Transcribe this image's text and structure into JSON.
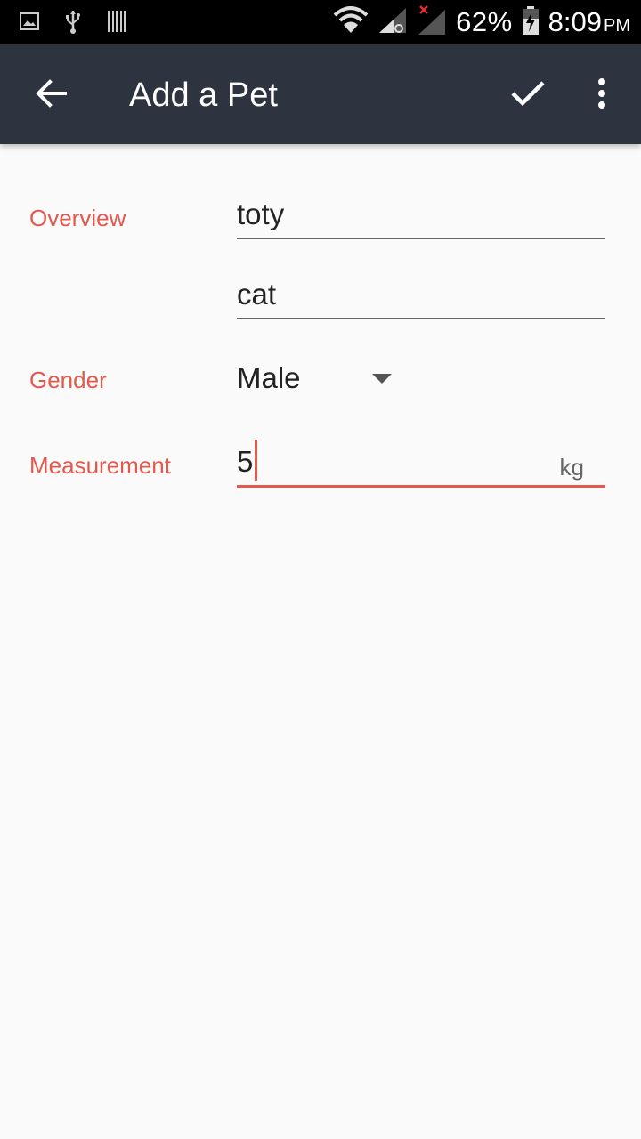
{
  "status_bar": {
    "battery_percent": "62%",
    "time": "8:09",
    "ampm": "PM",
    "icons": [
      "image-icon",
      "usb-icon",
      "barcode-icon",
      "wifi-icon",
      "signal-icon",
      "signal-no-sim-icon",
      "battery-charging-icon"
    ]
  },
  "app_bar": {
    "title": "Add a Pet",
    "background": "#2d3440",
    "back_icon": "arrow-back-icon",
    "confirm_icon": "check-icon",
    "menu_icon": "more-vert-icon"
  },
  "form": {
    "accent_color": "#e25a4e",
    "overview_label": "Overview",
    "name_value": "toty",
    "species_value": "cat",
    "gender_label": "Gender",
    "gender_value": "Male",
    "measurement_label": "Measurement",
    "measurement_value": "5",
    "measurement_unit": "kg"
  }
}
